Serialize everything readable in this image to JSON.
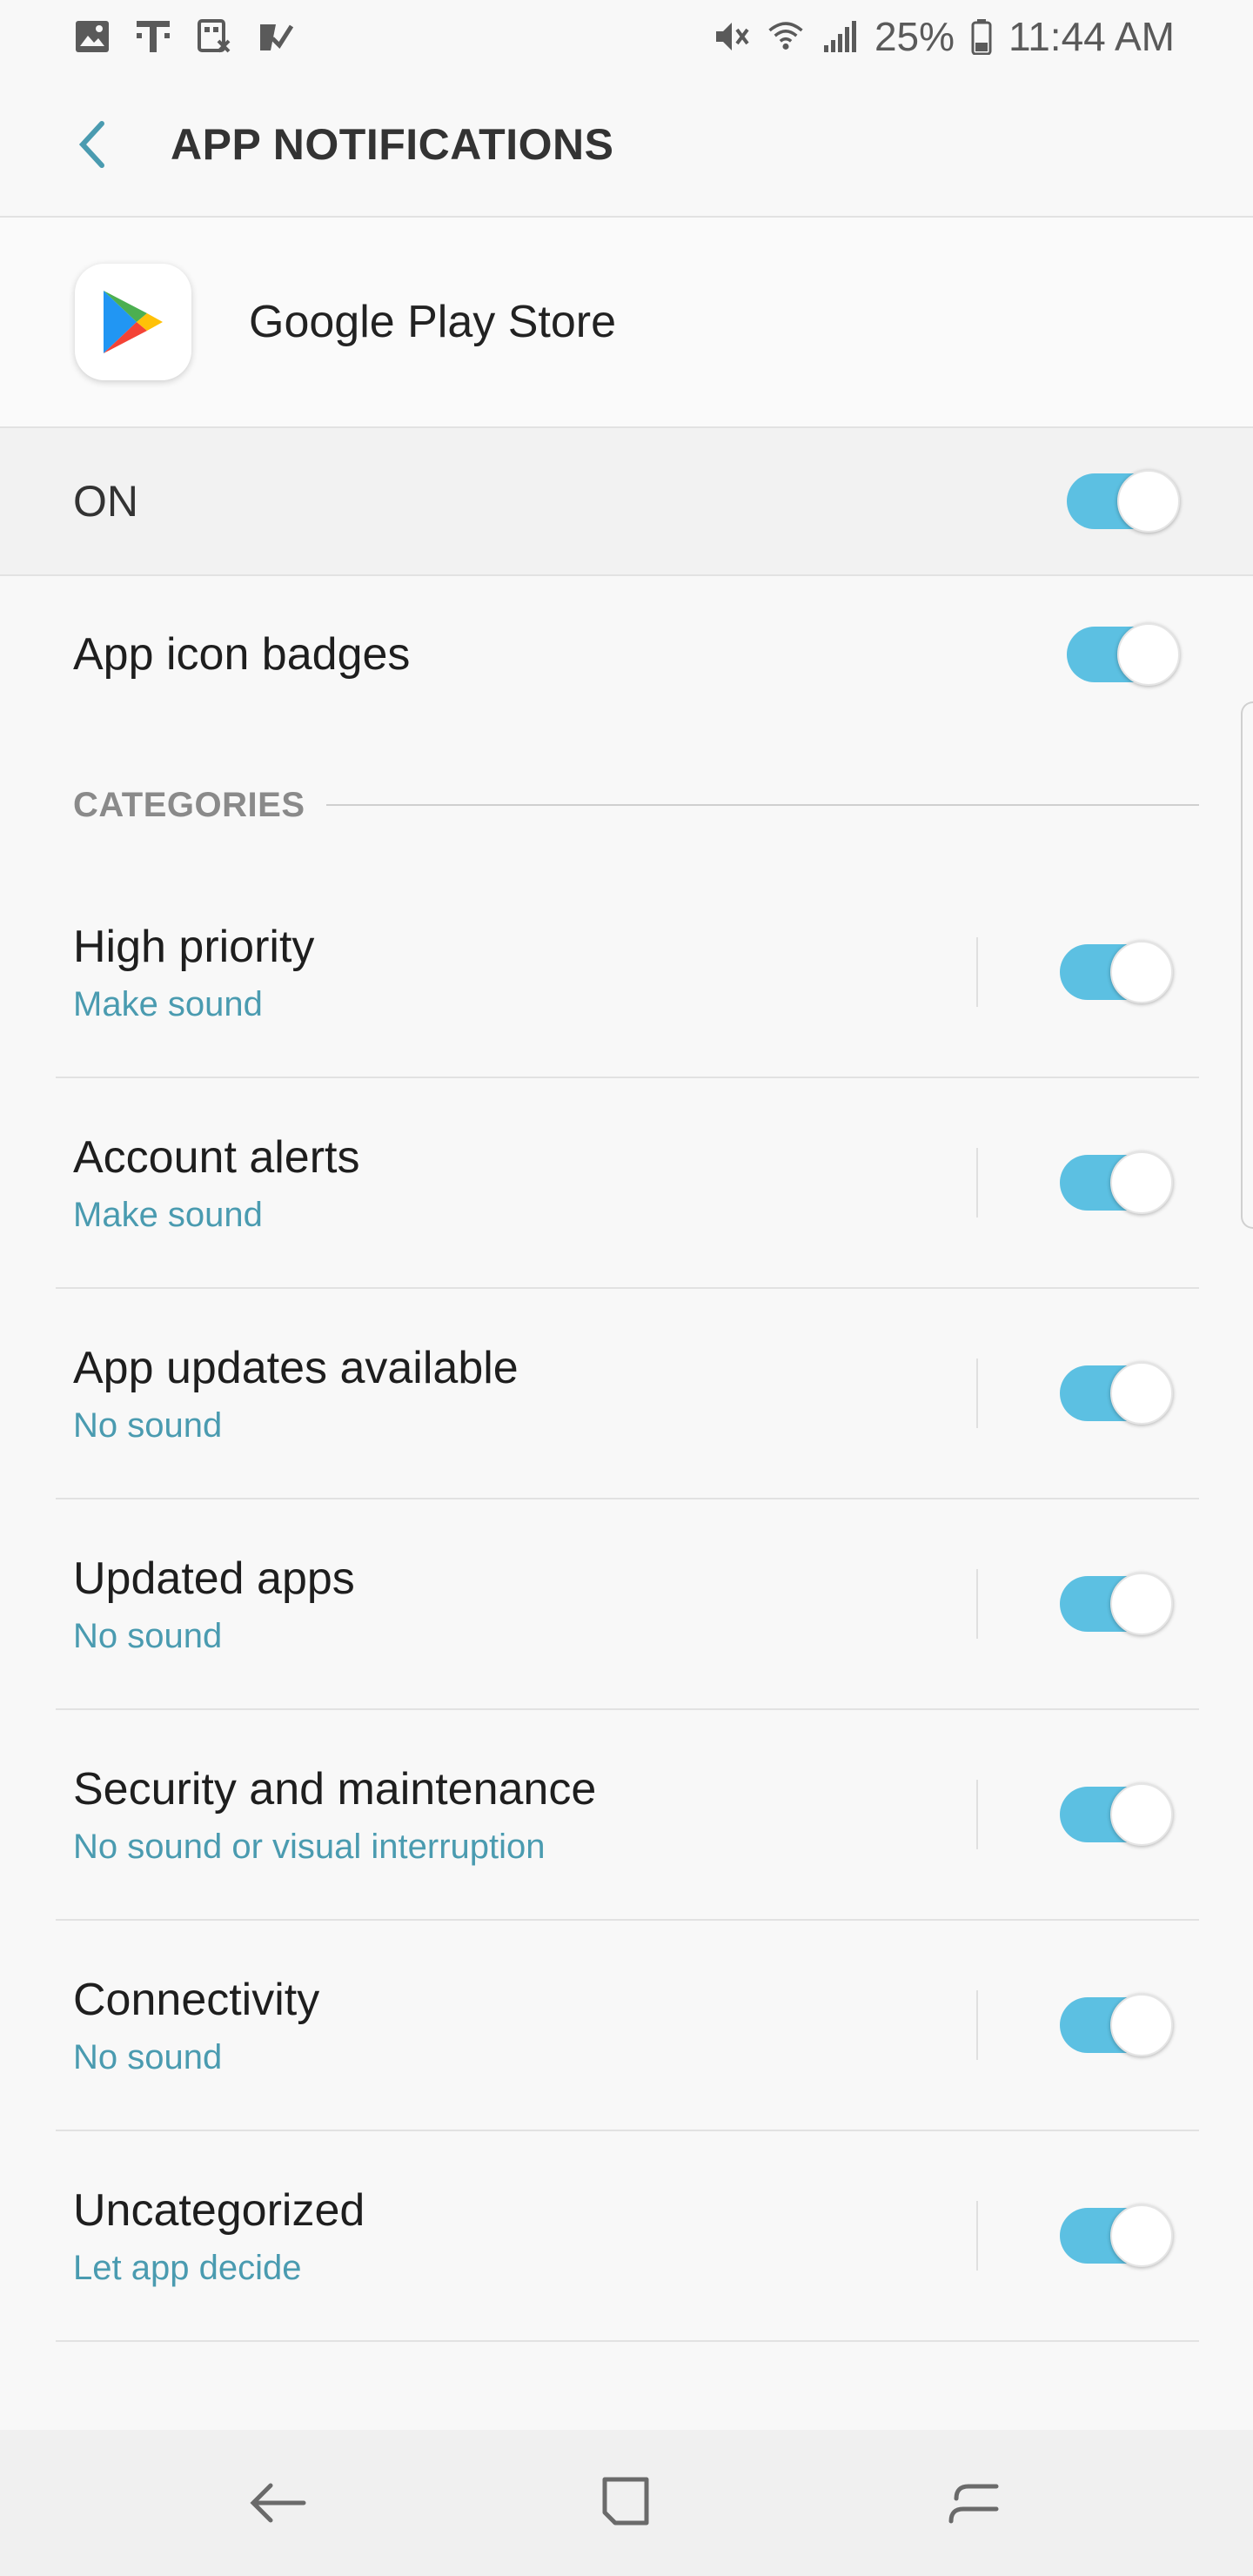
{
  "status_bar": {
    "battery": "25%",
    "time": "11:44 AM",
    "left_icons": [
      "gallery-icon",
      "t-mobile-icon",
      "app-icon",
      "task-check-icon"
    ],
    "right_icons": [
      "mute-icon",
      "wifi-icon",
      "signal-icon",
      "battery-icon"
    ]
  },
  "app_bar": {
    "title": "APP NOTIFICATIONS",
    "back_icon": "back-chevron-icon"
  },
  "app": {
    "name": "Google Play Store",
    "icon": "google-play-icon"
  },
  "master": {
    "label": "ON",
    "enabled": true
  },
  "badges": {
    "label": "App icon badges",
    "enabled": true
  },
  "section": {
    "title": "CATEGORIES"
  },
  "categories": [
    {
      "title": "High priority",
      "subtitle": "Make sound",
      "enabled": true
    },
    {
      "title": "Account alerts",
      "subtitle": "Make sound",
      "enabled": true
    },
    {
      "title": "App updates available",
      "subtitle": "No sound",
      "enabled": true
    },
    {
      "title": "Updated apps",
      "subtitle": "No sound",
      "enabled": true
    },
    {
      "title": "Security and maintenance",
      "subtitle": "No sound or visual interruption",
      "enabled": true
    },
    {
      "title": "Connectivity",
      "subtitle": "No sound",
      "enabled": true
    },
    {
      "title": "Uncategorized",
      "subtitle": "Let app decide",
      "enabled": true
    }
  ],
  "colors": {
    "accent": "#5cc0e2",
    "subtitle": "#4a9bb0",
    "background": "#f8f8f8"
  },
  "nav_bar": {
    "icons": [
      "nav-back-icon",
      "nav-home-icon",
      "nav-recents-icon"
    ]
  }
}
